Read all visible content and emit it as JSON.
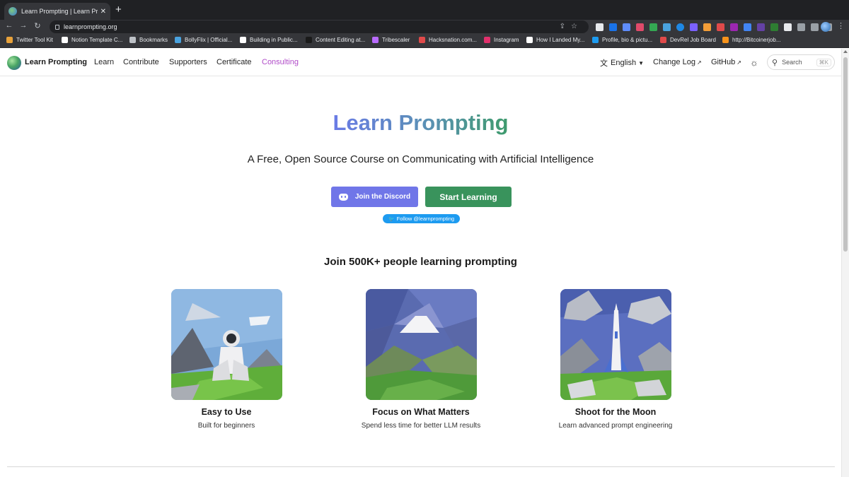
{
  "browser": {
    "tab_title": "Learn Prompting | Learn Promp",
    "tab_close": "✕",
    "new_tab": "+",
    "url": "learnprompting.org",
    "bookmarks": [
      {
        "label": "Twitter Tool Kit",
        "color": "#e8a23b"
      },
      {
        "label": "Notion Template C...",
        "color": "#ffffff"
      },
      {
        "label": "Bookmarks",
        "color": "#bdc1c6"
      },
      {
        "label": "BollyFlix | Official...",
        "color": "#4aa3df"
      },
      {
        "label": "Building in Public...",
        "color": "#ffffff"
      },
      {
        "label": "Content Editing at...",
        "color": "#1a1a1a"
      },
      {
        "label": "Tribescaler",
        "color": "#b96bff"
      },
      {
        "label": "Hacksnation.com...",
        "color": "#e04a4a"
      },
      {
        "label": "Instagram",
        "color": "#e1306c"
      },
      {
        "label": "How I Landed My...",
        "color": "#ffffff"
      },
      {
        "label": "Profile, bio & pictu...",
        "color": "#1d9bf0"
      },
      {
        "label": "DevRel Job Board",
        "color": "#e04a4a"
      },
      {
        "label": "http://Bitcoinerjob...",
        "color": "#f7931a"
      }
    ]
  },
  "header": {
    "brand": "Learn Prompting",
    "nav": [
      {
        "label": "Learn",
        "accent": false
      },
      {
        "label": "Contribute",
        "accent": false
      },
      {
        "label": "Supporters",
        "accent": false
      },
      {
        "label": "Certificate",
        "accent": false
      },
      {
        "label": "Consulting",
        "accent": true
      }
    ],
    "language": "English",
    "changelog": "Change Log",
    "github": "GitHub",
    "search_label": "Search",
    "search_shortcut": "⌘K"
  },
  "hero": {
    "title": "Learn Prompting",
    "subtitle": "A Free, Open Source Course on Communicating with Artificial Intelligence",
    "discord_button": "Join the Discord",
    "start_button": "Start Learning",
    "follow_badge": "Follow @learnprompting"
  },
  "join_title": "Join 500K+ people learning prompting",
  "features": [
    {
      "title": "Easy to Use",
      "desc": "Built for beginners",
      "icon": "astronaut-illustration"
    },
    {
      "title": "Focus on What Matters",
      "desc": "Spend less time for better LLM results",
      "icon": "mountain-valley-illustration"
    },
    {
      "title": "Shoot for the Moon",
      "desc": "Learn advanced prompt engineering",
      "icon": "rocket-illustration"
    }
  ],
  "colors": {
    "discord": "#7076e8",
    "start": "#39935c",
    "consulting": "#b04bc8",
    "twitter": "#1d9bf0"
  }
}
